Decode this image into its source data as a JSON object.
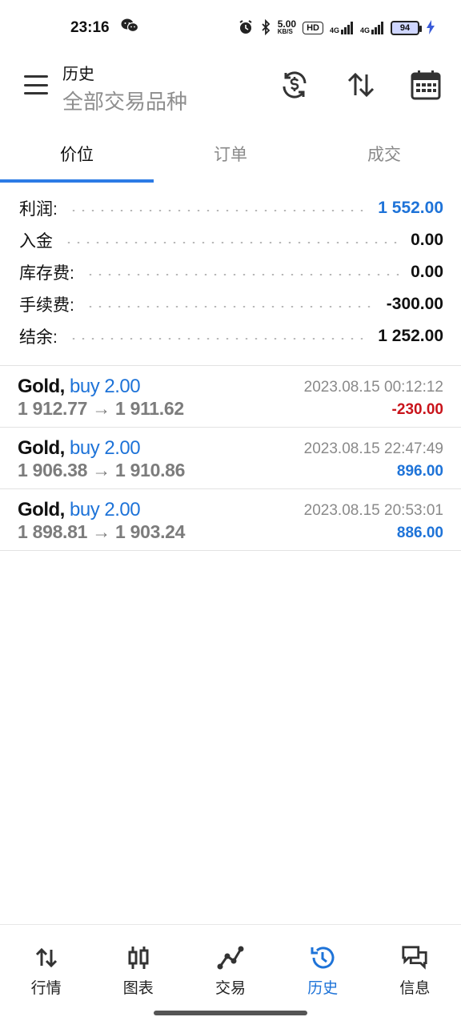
{
  "status_bar": {
    "time": "23:16",
    "net_speed": "5.00",
    "net_unit": "KB/S",
    "hd_badge": "HD",
    "sig1": "4G",
    "sig2": "4G",
    "battery": "94",
    "icons": [
      "wechat-icon",
      "alarm-icon",
      "bluetooth-icon",
      "signal-icon",
      "battery-icon",
      "charging-icon"
    ]
  },
  "header": {
    "title": "历史",
    "subtitle": "全部交易品种",
    "icons": [
      "menu-icon",
      "currency-sync-icon",
      "sort-icon",
      "calendar-icon"
    ]
  },
  "tabs": [
    {
      "label": "价位",
      "active": true
    },
    {
      "label": "订单",
      "active": false
    },
    {
      "label": "成交",
      "active": false
    }
  ],
  "summary": [
    {
      "label": "利润:",
      "value": "1 552.00",
      "color": "#1e73d8"
    },
    {
      "label": "入金",
      "value": "0.00",
      "color": "#111111"
    },
    {
      "label": "库存费:",
      "value": "0.00",
      "color": "#111111"
    },
    {
      "label": "手续费:",
      "value": "-300.00",
      "color": "#111111"
    },
    {
      "label": "结余:",
      "value": "1 252.00",
      "color": "#111111"
    }
  ],
  "deals": [
    {
      "symbol": "Gold,",
      "side": "buy 2.00",
      "prices": "1 912.77 → 1 911.62",
      "time": "2023.08.15 00:12:12",
      "profit": "-230.00",
      "profit_sign": "neg"
    },
    {
      "symbol": "Gold,",
      "side": "buy 2.00",
      "prices": "1 906.38 → 1 910.86",
      "time": "2023.08.15 22:47:49",
      "profit": "896.00",
      "profit_sign": "pos"
    },
    {
      "symbol": "Gold,",
      "side": "buy 2.00",
      "prices": "1 898.81 → 1 903.24",
      "time": "2023.08.15 20:53:01",
      "profit": "886.00",
      "profit_sign": "pos"
    }
  ],
  "bottom_nav": [
    {
      "label": "行情",
      "icon": "quotes-icon",
      "active": false
    },
    {
      "label": "图表",
      "icon": "chart-icon",
      "active": false
    },
    {
      "label": "交易",
      "icon": "trade-icon",
      "active": false
    },
    {
      "label": "历史",
      "icon": "history-icon",
      "active": true
    },
    {
      "label": "信息",
      "icon": "messages-icon",
      "active": false
    }
  ],
  "colors": {
    "accent": "#1e73d8",
    "negative": "#c9141b",
    "muted": "#8a8a8a"
  }
}
